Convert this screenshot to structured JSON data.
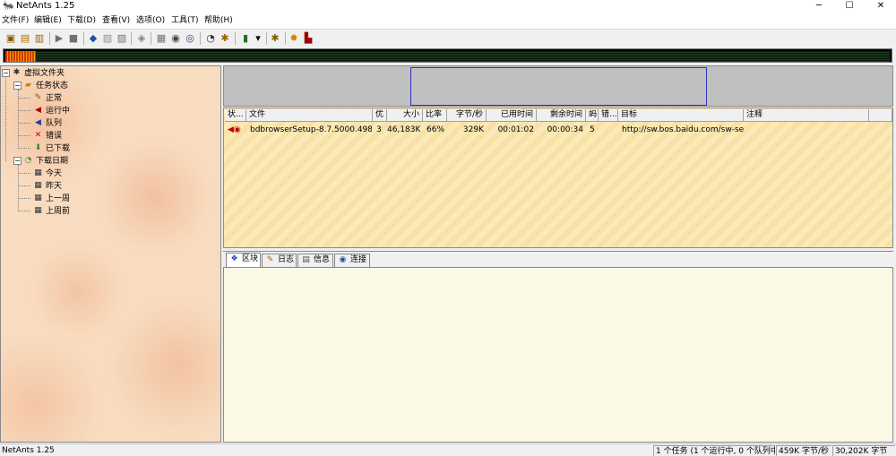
{
  "window": {
    "title": "NetAnts 1.25",
    "app_icon": "netants-icon",
    "controls": {
      "minimize": "─",
      "maximize": "☐",
      "close": "✕"
    }
  },
  "menu": [
    "文件(F)",
    "编辑(E)",
    "下载(D)",
    "查看(V)",
    "选项(O)",
    "工具(T)",
    "帮助(H)"
  ],
  "toolbar": [
    {
      "icon": "new-task-icon",
      "glyph": "▣"
    },
    {
      "icon": "add-batch-icon",
      "glyph": "▤"
    },
    {
      "icon": "open-folder-icon",
      "glyph": "▥"
    },
    {
      "icon": "start-icon",
      "glyph": "▶"
    },
    {
      "icon": "stop-icon",
      "glyph": "■"
    },
    {
      "icon": "move-up-icon",
      "glyph": "◆"
    },
    {
      "icon": "delete-icon",
      "glyph": "▧"
    },
    {
      "icon": "properties-icon",
      "glyph": "▨"
    },
    {
      "icon": "monitor-icon",
      "glyph": "◈"
    },
    {
      "icon": "options-icon",
      "glyph": "▦"
    },
    {
      "icon": "globe-icon",
      "glyph": "◉"
    },
    {
      "icon": "schedule-icon",
      "glyph": "◔"
    },
    {
      "icon": "connect-icon",
      "glyph": "◎"
    },
    {
      "icon": "traffic-light-icon",
      "glyph": "▮"
    },
    {
      "icon": "dropdown-arrow-icon",
      "glyph": "▾"
    },
    {
      "icon": "ant-icon",
      "glyph": "✱"
    },
    {
      "icon": "gear-icon",
      "glyph": "✹"
    },
    {
      "icon": "exit-icon",
      "glyph": "▙"
    }
  ],
  "tree": {
    "root": "虚拟文件夹",
    "groups": [
      {
        "label": "任务状态",
        "items": [
          {
            "label": "正常",
            "icon": "pencil-icon",
            "glyph": "✎"
          },
          {
            "label": "运行中",
            "icon": "running-icon",
            "glyph": "◀"
          },
          {
            "label": "队列",
            "icon": "queue-icon",
            "glyph": "◀"
          },
          {
            "label": "错误",
            "icon": "error-icon",
            "glyph": "✕"
          },
          {
            "label": "已下载",
            "icon": "downloaded-icon",
            "glyph": "⬇"
          }
        ]
      },
      {
        "label": "下载日期",
        "items": [
          {
            "label": "今天",
            "icon": "calendar-icon",
            "glyph": "▦"
          },
          {
            "label": "昨天",
            "icon": "calendar-icon",
            "glyph": "▦"
          },
          {
            "label": "上一周",
            "icon": "calendar-icon",
            "glyph": "▦"
          },
          {
            "label": "上周前",
            "icon": "calendar-icon",
            "glyph": "▦"
          }
        ]
      }
    ]
  },
  "table": {
    "columns": [
      "状...",
      "文件",
      "优",
      "大小",
      "比率",
      "字节/秒",
      "已用时间",
      "剩余时间",
      "蚂",
      "错...",
      "目标",
      "注释"
    ],
    "rows": [
      {
        "status_icon": "running-icon",
        "file": "bdbrowserSetup-8.7.5000.498...",
        "priority": "3",
        "size": "46,183K",
        "ratio": "66%",
        "speed": "329K",
        "elapsed": "00:01:02",
        "remaining": "00:00:34",
        "ants": "5",
        "errors": "",
        "target": "http://sw.bos.baidu.com/sw-se...",
        "notes": ""
      }
    ]
  },
  "tabs": [
    {
      "label": "区块",
      "icon": "blocks-icon",
      "glyph": "❖"
    },
    {
      "label": "日志",
      "icon": "log-icon",
      "glyph": "✎"
    },
    {
      "label": "信息",
      "icon": "info-icon",
      "glyph": "▤"
    },
    {
      "label": "连接",
      "icon": "connection-icon",
      "glyph": "◉"
    }
  ],
  "statusbar": {
    "app": "NetAnts 1.25",
    "tasks": "1 个任务 (1 个运行中, 0 个队列中)",
    "speed": "459K 字节/秒",
    "total": "30,202K 字节"
  },
  "colors": {
    "progress_active": "#d43a00",
    "selection_box": "#3030c0",
    "table_bg": "#fbe9b8"
  }
}
